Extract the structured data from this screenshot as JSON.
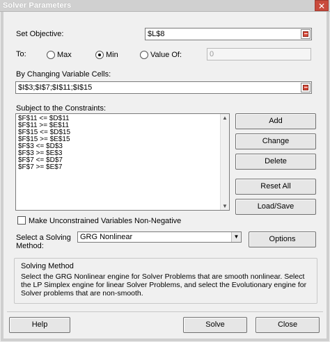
{
  "window": {
    "title": "Solver Parameters",
    "close_glyph": "✕"
  },
  "objective": {
    "label": "Set Objective:",
    "value": "$L$8"
  },
  "to": {
    "label": "To:",
    "options": [
      {
        "label": "Max",
        "selected": false
      },
      {
        "label": "Min",
        "selected": true
      },
      {
        "label": "Value Of:",
        "selected": false
      }
    ],
    "value_of": "0"
  },
  "changing_cells": {
    "label": "By Changing Variable Cells:",
    "value": "$I$3;$I$7;$I$11;$I$15"
  },
  "constraints": {
    "label": "Subject to the Constraints:",
    "items": [
      "$F$11 <= $D$11",
      "$F$11 >= $E$11",
      "$F$15 <= $D$15",
      "$F$15 >= $E$15",
      "$F$3 <= $D$3",
      "$F$3 >= $E$3",
      "$F$7 <= $D$7",
      "$F$7 >= $E$7"
    ]
  },
  "buttons": {
    "add": "Add",
    "change": "Change",
    "delete": "Delete",
    "reset_all": "Reset All",
    "load_save": "Load/Save",
    "options": "Options",
    "help": "Help",
    "solve": "Solve",
    "close": "Close"
  },
  "nonnegative": {
    "label": "Make Unconstrained Variables Non-Negative",
    "checked": false
  },
  "solving_method": {
    "label_line1": "Select a Solving",
    "label_line2": "Method:",
    "selected": "GRG Nonlinear"
  },
  "method_group": {
    "title": "Solving Method",
    "description": "Select the GRG Nonlinear engine for Solver Problems that are smooth nonlinear. Select the LP Simplex engine for linear Solver Problems, and select the Evolutionary engine for Solver problems that are non-smooth."
  }
}
